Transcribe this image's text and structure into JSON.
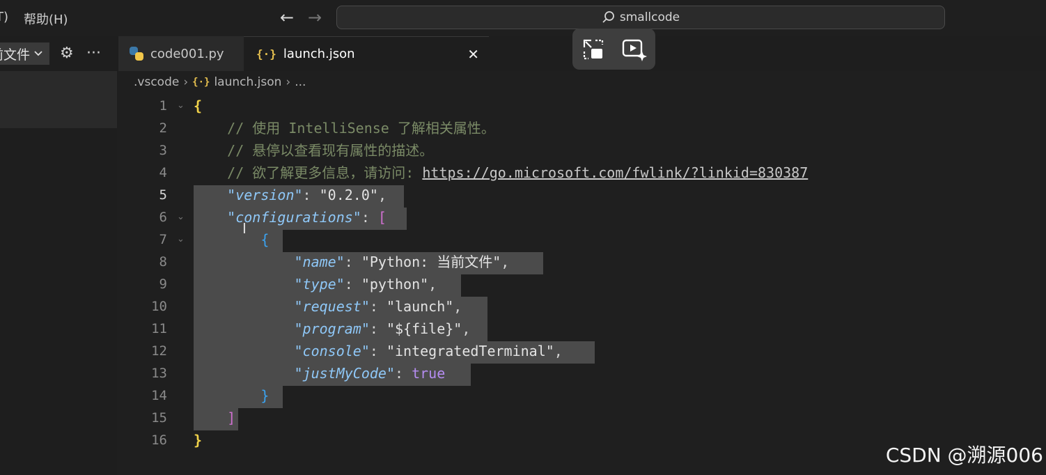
{
  "menubar": {
    "partial_item": "T)",
    "help": "帮助(H)"
  },
  "search": {
    "text": "smallcode"
  },
  "explorer": {
    "title": "前文件"
  },
  "tabs": [
    {
      "label": "code001.py",
      "icon": "python-icon",
      "active": false
    },
    {
      "label": "launch.json",
      "icon": "json-braces-icon",
      "active": true
    }
  ],
  "breadcrumb": [
    ".vscode",
    "launch.json",
    "..."
  ],
  "current_line": 5,
  "selection_lines": "5-15",
  "code_lines": [
    {
      "num": "1",
      "text": "{"
    },
    {
      "num": "2",
      "text": "    // 使用 IntelliSense 了解相关属性。"
    },
    {
      "num": "3",
      "text": "    // 悬停以查看现有属性的描述。"
    },
    {
      "num": "4",
      "text": "    // 欲了解更多信息，请访问: https://go.microsoft.com/fwlink/?linkid=830387"
    },
    {
      "num": "5",
      "text": "    \"version\": \"0.2.0\","
    },
    {
      "num": "6",
      "text": "    \"configurations\": ["
    },
    {
      "num": "7",
      "text": "        {"
    },
    {
      "num": "8",
      "text": "            \"name\": \"Python: 当前文件\","
    },
    {
      "num": "9",
      "text": "            \"type\": \"python\","
    },
    {
      "num": "10",
      "text": "            \"request\": \"launch\","
    },
    {
      "num": "11",
      "text": "            \"program\": \"${file}\","
    },
    {
      "num": "12",
      "text": "            \"console\": \"integratedTerminal\","
    },
    {
      "num": "13",
      "text": "            \"justMyCode\": true"
    },
    {
      "num": "14",
      "text": "        }"
    },
    {
      "num": "15",
      "text": "    ]"
    },
    {
      "num": "16",
      "text": "}"
    }
  ],
  "watermark": "CSDN @溯源006"
}
